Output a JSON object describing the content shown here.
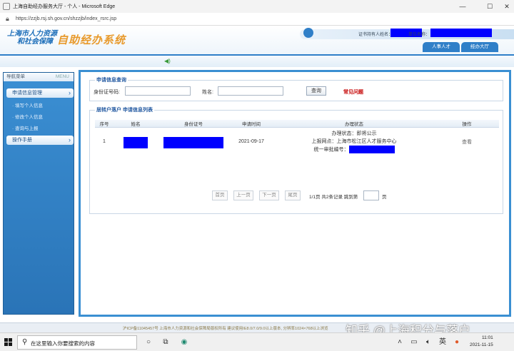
{
  "browser": {
    "title": "上海自助经办服务大厅 - 个人 - Microsoft Edge",
    "url": "https://zzjb.rsj.sh.gov.cn/shzzjb/index_rsrc.jsp",
    "controls": {
      "minimize": "—",
      "maximize": "☐",
      "close": "✕"
    }
  },
  "header": {
    "org_line1": "上海市人力资源",
    "org_line2": "和社会保障",
    "system_name": "自助经办系统",
    "cert_holder_label": "证书持有人姓名：",
    "unit_label": "单位名称：",
    "tabs": [
      "人事人才",
      "经办大厅"
    ]
  },
  "sidebar": {
    "title": "导航菜单",
    "title_right": "MENU",
    "sections": [
      {
        "label": "申请信息管理",
        "items": [
          "· 填写个人信息",
          "· 修改个人信息",
          "· 查询与上报"
        ]
      },
      {
        "label": "操作手册",
        "items": []
      }
    ]
  },
  "query": {
    "title": "申请信息查询",
    "id_label": "身份证号码:",
    "id_value": "",
    "name_label": "姓名:",
    "name_value": "",
    "search_button": "查询",
    "faq_link": "常见问题"
  },
  "list": {
    "title": "居转户落户 申请信息列表",
    "columns": [
      "序号",
      "姓名",
      "身份证号",
      "申请时间",
      "办理状态",
      "操作"
    ],
    "rows": [
      {
        "index": "1",
        "apply_date": "2021-09-17",
        "status_line1": "办理状态：即将公示",
        "status_line2": "上报网点：上海市松江区人才服务中心",
        "status_line3": "统一审批编号：",
        "action": "查看"
      }
    ]
  },
  "pagination": {
    "first": "首页",
    "prev": "上一页",
    "next": "下一页",
    "last": "尾页",
    "summary": "1/1页 共2条记录 跳到第",
    "page_input": "",
    "page_suffix": "页"
  },
  "footer": {
    "copyright": "沪ICP备11045457号  上海市人力资源和社会保障局版权所有  建议使用IE8.0/7.0/9.0以上版本, 分辨率1024×768以上浏览",
    "watermark": "知乎 @上海积分与落户"
  },
  "taskbar": {
    "search_placeholder": "在这里输入你要搜索的内容",
    "time": "11:01",
    "date": "2021-11-15"
  },
  "colors": {
    "accent": "#2f7fc8",
    "brand_orange": "#e89a2c",
    "redaction": "#0000ff",
    "faq_red": "#c40000"
  }
}
